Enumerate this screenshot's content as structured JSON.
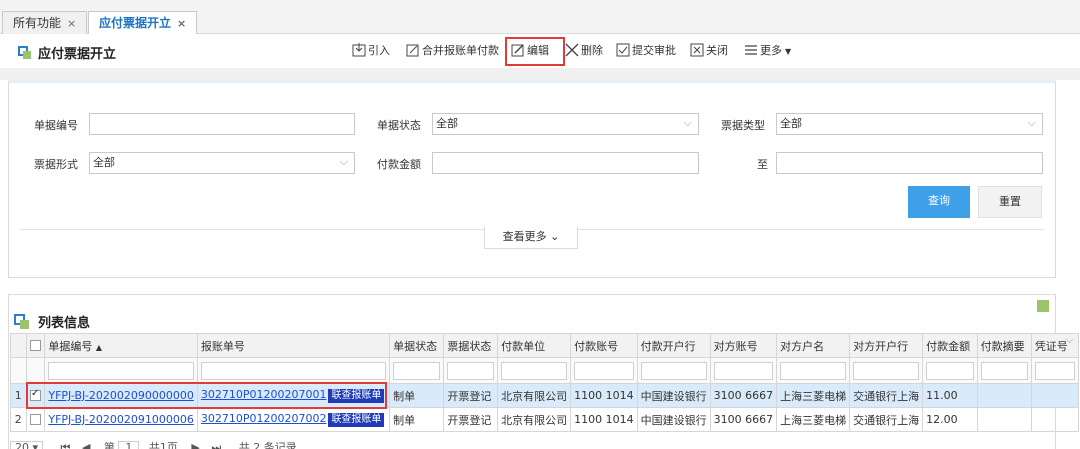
{
  "tabs": [
    {
      "label": "所有功能",
      "close": "×"
    },
    {
      "label": "应付票据开立",
      "close": "×"
    }
  ],
  "toolbar": {
    "title": "应付票据开立",
    "buttons": [
      "引入",
      "合并报账单付款",
      "编辑",
      "删除",
      "提交审批",
      "关闭",
      "更多"
    ],
    "highlight_color": "#e03a3a"
  },
  "search": {
    "doc_no_label": "单据编号",
    "doc_status_label": "单据状态",
    "doc_status_value": "全部",
    "bill_type_label": "票据类型",
    "bill_type_value": "全部",
    "bill_form_label": "票据形式",
    "bill_form_value": "全部",
    "amount_label": "付款金额",
    "to_label": "至",
    "query_label": "查询",
    "reset_label": "重置",
    "more_label": "查看更多"
  },
  "list": {
    "title": "列表信息",
    "columns": [
      "单据编号",
      "报账单号",
      "单据状态",
      "票据状态",
      "付款单位",
      "付款账号",
      "付款开户行",
      "对方账号",
      "对方户名",
      "对方开户行",
      "付款金额",
      "付款摘要",
      "凭证号"
    ],
    "sort_indicator": "▲",
    "badge_label": "联查报账单",
    "rows": [
      {
        "index": "1",
        "doc_no": "YFPJ-BJ-202002090000000",
        "report_no": "302710P01200207001",
        "doc_status": "制单",
        "bill_status": "开票登记",
        "pay_unit": "北京有限公司",
        "pay_acct": "1100 1014",
        "pay_bank": "中国建设银行",
        "peer_acct": "3100 6667",
        "peer_name": "上海三菱电梯",
        "peer_bank": "交通银行上海",
        "amount": "11.00",
        "memo": "",
        "voucher": ""
      },
      {
        "index": "2",
        "doc_no": "YFPJ-BJ-202002091000006",
        "report_no": "302710P01200207002",
        "doc_status": "制单",
        "bill_status": "开票登记",
        "pay_unit": "北京有限公司",
        "pay_acct": "1100 1014",
        "pay_bank": "中国建设银行",
        "peer_acct": "3100 6667",
        "peer_name": "上海三菱电梯",
        "peer_bank": "交通银行上海",
        "amount": "12.00",
        "memo": "",
        "voucher": ""
      }
    ]
  },
  "pager": {
    "page_size": "20",
    "page_prefix": "第",
    "page_no": "1",
    "page_total": "共1页",
    "records": "共 2 条记录"
  }
}
